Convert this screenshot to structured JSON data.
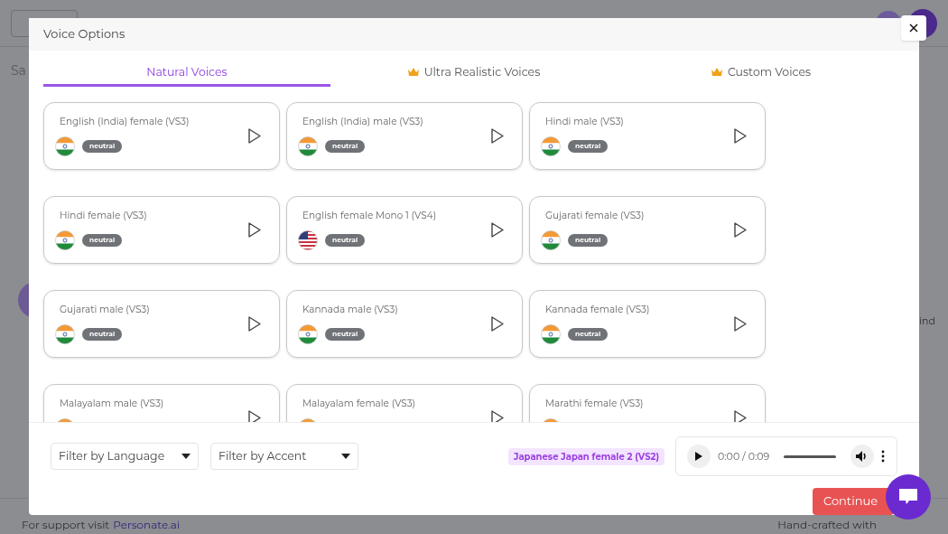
{
  "background": {
    "toolbar_text": "Sa",
    "side_text": "ind",
    "footer": {
      "support_text": "For support visit",
      "support_link": "Personate.ai",
      "credit": "Hand-crafted with"
    }
  },
  "dialog": {
    "title": "Voice Options",
    "tabs": [
      {
        "label": "Natural Voices",
        "selected": true,
        "premium": false
      },
      {
        "label": "Ultra Realistic Voices",
        "selected": false,
        "premium": true
      },
      {
        "label": "Custom Voices",
        "selected": false,
        "premium": true
      }
    ],
    "voices": [
      {
        "name": "English (India) female (VS3)",
        "kind": "india",
        "tag": "neutral"
      },
      {
        "name": "English (India) male (VS3)",
        "kind": "india",
        "tag": "neutral"
      },
      {
        "name": "Hindi male (VS3)",
        "kind": "india",
        "tag": "neutral"
      },
      {
        "name": "Hindi female (VS3)",
        "kind": "india",
        "tag": "neutral"
      },
      {
        "name": "English female Mono 1 (VS4)",
        "kind": "usa",
        "tag": "neutral"
      },
      {
        "name": "Gujarati female (VS3)",
        "kind": "india",
        "tag": "neutral"
      },
      {
        "name": "Gujarati male (VS3)",
        "kind": "india",
        "tag": "neutral"
      },
      {
        "name": "Kannada male (VS3)",
        "kind": "india",
        "tag": "neutral"
      },
      {
        "name": "Kannada female (VS3)",
        "kind": "india",
        "tag": "neutral"
      },
      {
        "name": "Malayalam male (VS3)",
        "kind": "india"
      },
      {
        "name": "Malayalam female (VS3)",
        "kind": "india"
      },
      {
        "name": "Marathi female (VS3)",
        "kind": "india"
      }
    ],
    "filters": [
      {
        "placeholder": "Filter by Language"
      },
      {
        "placeholder": "Filter by Accent"
      }
    ],
    "selected_voice": "Japanese Japan female 2 (VS2)",
    "player": {
      "time": "0:00 / 0:09",
      "level": 0
    },
    "continue_button": "Continue"
  }
}
